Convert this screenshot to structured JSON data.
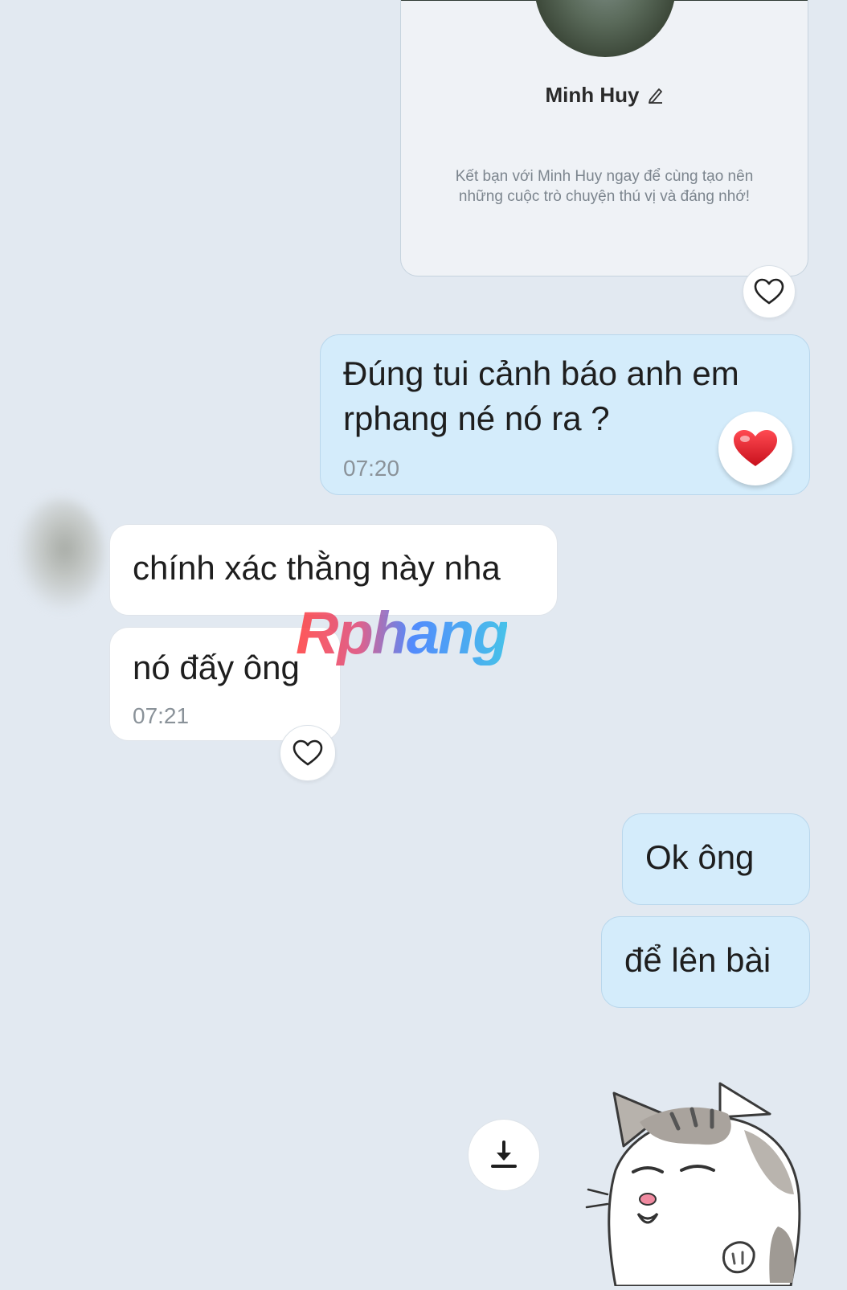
{
  "profile_card": {
    "name": "Minh Huy",
    "description": "Kết bạn với Minh Huy ngay để cùng tạo nên những cuộc trò chuyện thú vị và đáng nhớ!"
  },
  "messages": [
    {
      "direction": "outgoing",
      "text_line1": "Đúng tui cảnh báo anh em",
      "text_line2": "rphang né nó ra ?",
      "time": "07:20",
      "reaction": "heart-red"
    },
    {
      "direction": "incoming",
      "text": "chính xác thằng này nha"
    },
    {
      "direction": "incoming",
      "text": "nó đấy ông",
      "time": "07:21"
    },
    {
      "direction": "outgoing",
      "text": "Ok ông"
    },
    {
      "direction": "outgoing",
      "text": "để lên bài"
    }
  ],
  "watermark": "Rphang",
  "sticker": {
    "icon": "cat-sticker"
  },
  "colors": {
    "background": "#e2e9f1",
    "outgoing_bubble": "#d4ecfb",
    "incoming_bubble": "#ffffff",
    "heart": "#e41e2b"
  }
}
